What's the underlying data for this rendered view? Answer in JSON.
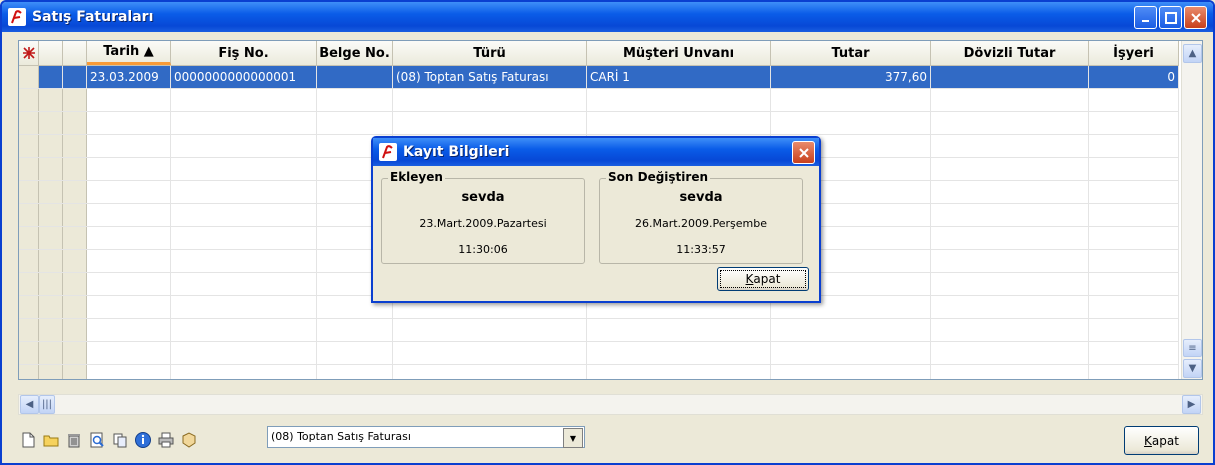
{
  "window": {
    "title": "Satış Faturaları"
  },
  "grid": {
    "columns": [
      {
        "key": "ind1",
        "label": "",
        "width": 20
      },
      {
        "key": "ind2",
        "label": "",
        "width": 24
      },
      {
        "key": "ind3",
        "label": "",
        "width": 24
      },
      {
        "key": "tarih",
        "label": "Tarih  ▲",
        "width": 84,
        "sorted": true
      },
      {
        "key": "fis",
        "label": "Fiş No.",
        "width": 146
      },
      {
        "key": "belge",
        "label": "Belge No.",
        "width": 76
      },
      {
        "key": "turu",
        "label": "Türü",
        "width": 194
      },
      {
        "key": "musteri",
        "label": "Müşteri Unvanı",
        "width": 184
      },
      {
        "key": "tutar",
        "label": "Tutar",
        "width": 160
      },
      {
        "key": "doviz",
        "label": "Dövizli Tutar",
        "width": 158
      },
      {
        "key": "isyeri",
        "label": "İşyeri",
        "width": 90
      }
    ],
    "rows": [
      {
        "tarih": "23.03.2009",
        "fis": "0000000000000001",
        "belge": "",
        "turu": "(08) Toptan Satış Faturası",
        "musteri": "CARİ 1",
        "tutar": "377,60",
        "doviz": "",
        "isyeri": "0"
      }
    ],
    "empty_rows": 13
  },
  "dialog": {
    "title": "Kayıt Bilgileri",
    "added": {
      "label": "Ekleyen",
      "user": "sevda",
      "date": "23.Mart.2009.Pazartesi",
      "time": "11:30:06"
    },
    "modified": {
      "label": "Son Değiştiren",
      "user": "sevda",
      "date": "26.Mart.2009.Perşembe",
      "time": "11:33:57"
    },
    "close_label_prefix": "",
    "close_label_key": "K",
    "close_label_rest": "apat"
  },
  "toolbar": {
    "icons": [
      "new-document-icon",
      "open-folder-icon",
      "delete-trash-icon",
      "search-preview-icon",
      "copy-icon",
      "info-icon",
      "print-icon",
      "filter-icon"
    ],
    "combo_value": "(08) Toptan Satış Faturası"
  },
  "footer": {
    "close_key": "K",
    "close_rest": "apat"
  }
}
